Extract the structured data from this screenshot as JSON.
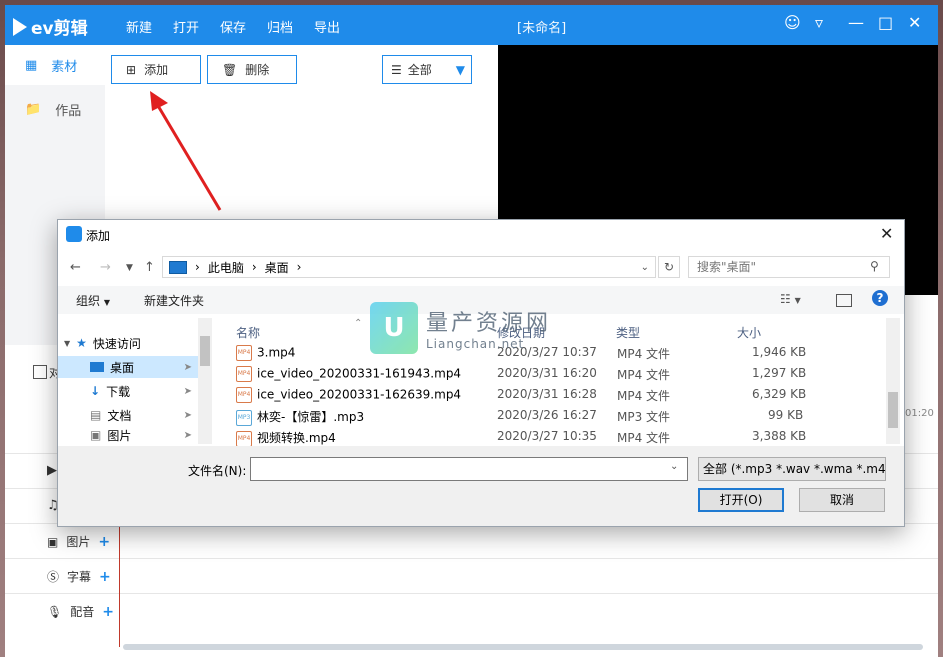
{
  "app": {
    "brand": "ev剪辑",
    "menu": [
      "新建",
      "打开",
      "保存",
      "归档",
      "导出"
    ],
    "title": "[未命名]",
    "sidebar": {
      "material": "素材",
      "works": "作品"
    },
    "toolbar": {
      "add": "添加",
      "delete": "删除",
      "filter": "全部"
    },
    "tracks": [
      {
        "label": "图片"
      },
      {
        "label": "字幕"
      },
      {
        "label": "配音"
      }
    ],
    "partial_checkbox": "对",
    "timecode": "01:20"
  },
  "dialog": {
    "title": "添加",
    "path": [
      "此电脑",
      "桌面"
    ],
    "search_placeholder": "搜索\"桌面\"",
    "commands": {
      "organize": "组织",
      "new_folder": "新建文件夹"
    },
    "nav": {
      "quick_access": "快速访问",
      "items": [
        "桌面",
        "下载",
        "文档",
        "图片"
      ]
    },
    "columns": {
      "name": "名称",
      "date": "修改日期",
      "type": "类型",
      "size": "大小"
    },
    "files": [
      {
        "name": "3.mp4",
        "date": "2020/3/27 10:37",
        "type": "MP4 文件",
        "size": "1,946 KB",
        "icon": "mp4"
      },
      {
        "name": "ice_video_20200331-161943.mp4",
        "date": "2020/3/31 16:20",
        "type": "MP4 文件",
        "size": "1,297 KB",
        "icon": "mp4"
      },
      {
        "name": "ice_video_20200331-162639.mp4",
        "date": "2020/3/31 16:28",
        "type": "MP4 文件",
        "size": "6,329 KB",
        "icon": "mp4"
      },
      {
        "name": "林奕-【惊雷】.mp3",
        "date": "2020/3/26 16:27",
        "type": "MP3 文件",
        "size": "99 KB",
        "icon": "mp3"
      },
      {
        "name": "视频转换.mp4",
        "date": "2020/3/27 10:35",
        "type": "MP4 文件",
        "size": "3,388 KB",
        "icon": "mp4"
      }
    ],
    "filename_label": "文件名(N):",
    "filename_value": "",
    "filter": "全部 (*.mp3 *.wav *.wma *.m4",
    "open": "打开(O)",
    "cancel": "取消"
  },
  "watermark": {
    "title": "量产资源网",
    "url": "Liangchan.net"
  },
  "colors": {
    "accent": "#1f8bea",
    "arrow": "#e02020"
  }
}
